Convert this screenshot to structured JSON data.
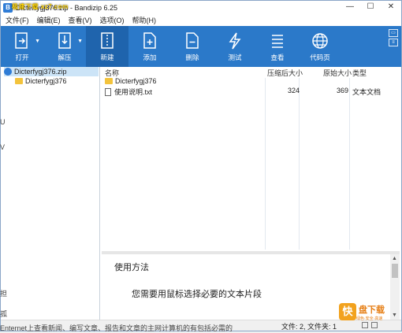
{
  "titlebar": {
    "title": "Dicterfygj376.zip - Bandizip 6.25",
    "overlay": "极速下载 xz7.com",
    "min": "—",
    "max": "☐",
    "close": "✕"
  },
  "menu": [
    "文件(F)",
    "编辑(E)",
    "查看(V)",
    "选项(O)",
    "帮助(H)"
  ],
  "toolbar": {
    "open": "打开",
    "extract": "解压",
    "new": "新建",
    "add": "添加",
    "delete": "删除",
    "test": "测试",
    "view": "查看",
    "codepage": "代码页"
  },
  "tree": {
    "root": "Dicterfygj376.zip",
    "child": "Dicterfygj376"
  },
  "list": {
    "headers": {
      "name": "名称",
      "packed": "压缩后大小",
      "size": "原始大小",
      "type": "类型"
    },
    "rows": [
      {
        "name": "Dicterfygj376",
        "packed": "",
        "size": "",
        "type": "",
        "kind": "folder"
      },
      {
        "name": "使用说明.txt",
        "packed": "324",
        "size": "369",
        "type": "文本文档",
        "kind": "file"
      }
    ]
  },
  "preview": {
    "title": "使用方法",
    "text": "您需要用鼠标选择必要的文本片段"
  },
  "status": {
    "text": "文件: 2, 文件夹: 1"
  },
  "bleed": [
    "U",
    "V",
    "担",
    "孤"
  ],
  "bottom_bleed": "Enternet上查看新闻、编写文章、报告和文章的主网计算机的有包括必需的",
  "watermark": {
    "logo": "快",
    "name": "盘下载",
    "sub": "绿色·安全·高速"
  },
  "colors": {
    "toolbar": "#2b79c9",
    "toolbar_active": "#1f64ad",
    "selection": "#cce4f7"
  }
}
